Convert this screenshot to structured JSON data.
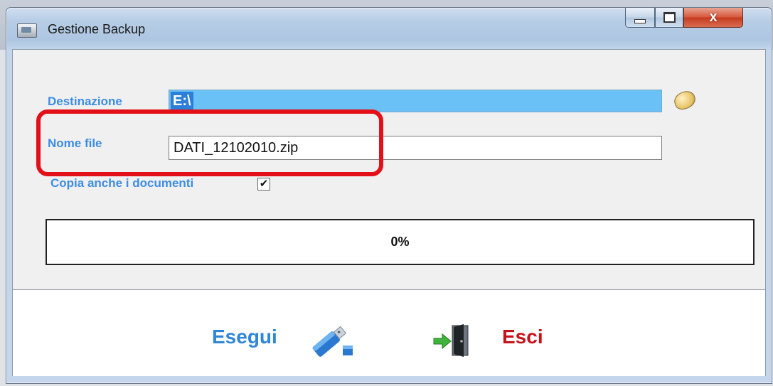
{
  "window": {
    "title": "Gestione Backup"
  },
  "form": {
    "destination_label": "Destinazione",
    "destination_value": "E:\\",
    "filename_label": "Nome file",
    "filename_value": "DATI_12102010.zip",
    "copy_docs_label": "Copia anche i documenti",
    "copy_docs_checked": true,
    "copy_docs_mark": "✔"
  },
  "progress": {
    "value_text": "0%",
    "value": 0
  },
  "footer": {
    "run_label": "Esegui",
    "exit_label": "Esci"
  },
  "colors": {
    "label_blue": "#3c8ce6",
    "exit_red": "#c8121a",
    "highlight_red": "#e3101a",
    "dest_field": "#6ac1f5"
  },
  "icons": {
    "app": "app-icon",
    "folder": "folder-icon",
    "run": "usb-drive-icon",
    "exit": "exit-door-icon"
  }
}
